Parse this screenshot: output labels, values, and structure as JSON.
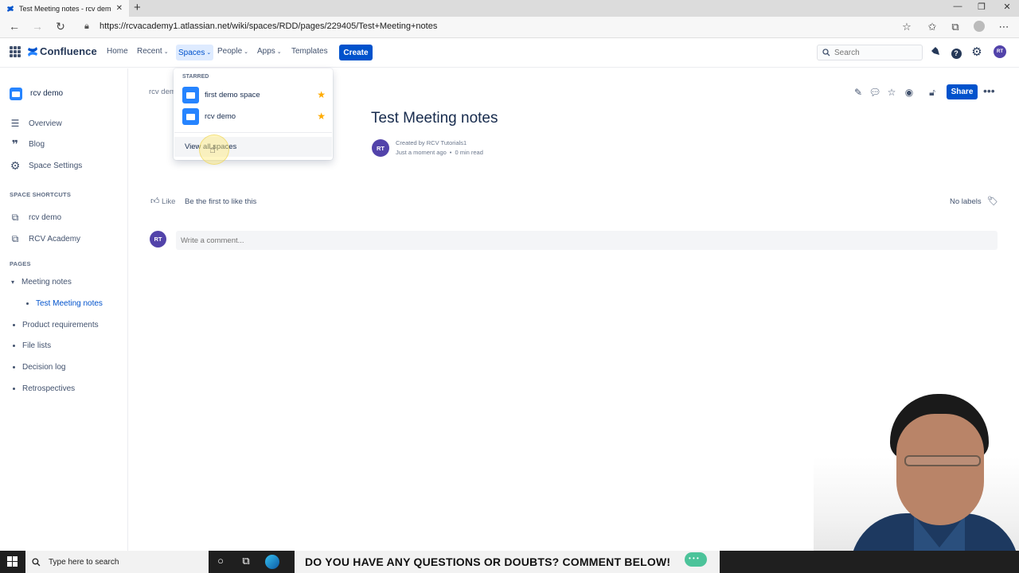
{
  "browser": {
    "tab_title": "Test Meeting notes - rcv demo -",
    "tab_close": "✕",
    "new_tab": "+",
    "url": "https://rcvacademy1.atlassian.net/wiki/spaces/RDD/pages/229405/Test+Meeting+notes"
  },
  "header": {
    "logo": "Confluence",
    "nav": {
      "home": "Home",
      "recent": "Recent",
      "spaces": "Spaces",
      "people": "People",
      "apps": "Apps",
      "templates": "Templates"
    },
    "create": "Create",
    "search_placeholder": "Search",
    "avatar": "RT"
  },
  "sidebar": {
    "space_name": "rcv demo",
    "items": [
      "Overview",
      "Blog",
      "Space Settings"
    ],
    "shortcuts_title": "SPACE SHORTCUTS",
    "shortcuts": [
      "rcv demo",
      "RCV Academy"
    ],
    "pages_title": "PAGES",
    "pages": {
      "meeting_notes": "Meeting notes",
      "test_meeting_notes": "Test Meeting notes",
      "product_requirements": "Product requirements",
      "file_lists": "File lists",
      "decision_log": "Decision log",
      "retrospectives": "Retrospectives"
    }
  },
  "page": {
    "breadcrumb": "rcv dem",
    "title": "Test Meeting notes",
    "author_avatar": "RT",
    "created_by": "Created by RCV Tutorials1",
    "time": "Just a moment ago",
    "dot": "•",
    "read_time": "0 min read",
    "share": "Share",
    "like": "Like",
    "first_like": "Be the first to like this",
    "no_labels": "No labels",
    "comment_avatar": "RT",
    "comment_placeholder": "Write a comment..."
  },
  "dropdown": {
    "starred_title": "STARRED",
    "spaces": [
      "first demo space",
      "rcv demo"
    ],
    "view_all": "View all spaces"
  },
  "taskbar": {
    "search_text": "Type here to search"
  },
  "banner": {
    "text": "DO YOU HAVE ANY QUESTIONS OR DOUBTS? COMMENT BELOW!"
  },
  "colors": {
    "primary": "#0052cc",
    "avatar": "#5243aa",
    "star": "#ffab00",
    "space_icon": "#2684ff"
  },
  "icons": [
    "grid-icon",
    "confluence-logo-icon",
    "search-icon",
    "notification-icon",
    "help-icon",
    "settings-icon",
    "edit-icon",
    "comment-icon",
    "star-icon",
    "watch-icon",
    "restrictions-icon",
    "more-icon",
    "like-icon",
    "label-icon"
  ]
}
